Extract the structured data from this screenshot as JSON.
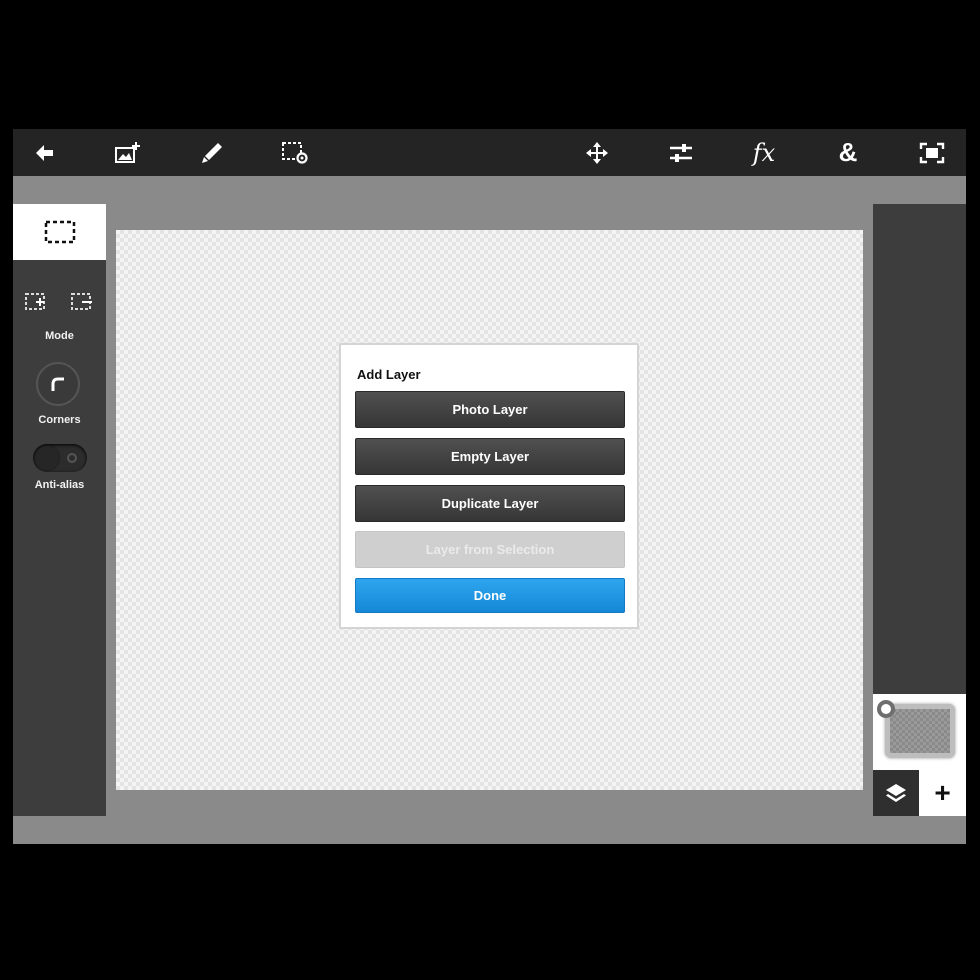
{
  "toolbar": {
    "items": [
      {
        "icon": "back-arrow-icon"
      },
      {
        "icon": "add-image-icon"
      },
      {
        "icon": "brush-icon"
      },
      {
        "icon": "selection-settings-icon"
      },
      {
        "icon": "move-icon"
      },
      {
        "icon": "adjustments-icon"
      },
      {
        "icon": "effects-icon",
        "glyph": "fx"
      },
      {
        "icon": "text-icon",
        "glyph": "&"
      },
      {
        "icon": "fullscreen-icon"
      }
    ]
  },
  "left_panel": {
    "active_tool_icon": "rect-select-icon",
    "mode_label": "Mode",
    "corners_label": "Corners",
    "antialias_label": "Anti-alias",
    "antialias_on": false
  },
  "dialog": {
    "title": "Add Layer",
    "buttons": [
      {
        "label": "Photo Layer",
        "style": "dark",
        "enabled": true
      },
      {
        "label": "Empty Layer",
        "style": "dark",
        "enabled": true
      },
      {
        "label": "Duplicate Layer",
        "style": "dark",
        "enabled": true
      },
      {
        "label": "Layer from Selection",
        "style": "disabled",
        "enabled": false
      },
      {
        "label": "Done",
        "style": "primary",
        "enabled": true
      }
    ]
  },
  "right_panel": {
    "add_layer_glyph": "+"
  },
  "colors": {
    "accent": "#1a8fdd",
    "toolbar_bg": "#242424",
    "panel_bg": "#3d3d3d",
    "workspace_bg": "#8a8a8a"
  }
}
